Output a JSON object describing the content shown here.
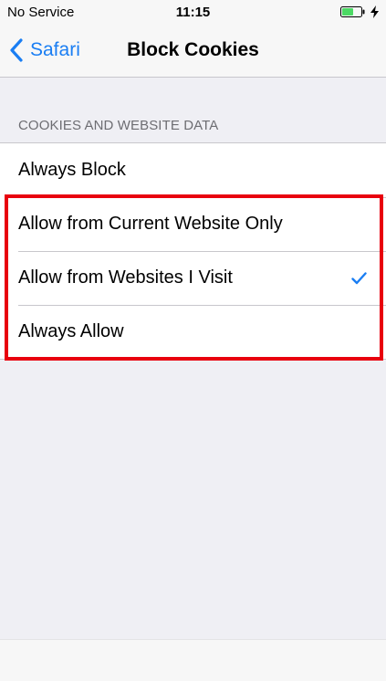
{
  "status_bar": {
    "carrier": "No Service",
    "time": "11:15",
    "battery_icon": "battery-charging-icon",
    "battery_color": "#4cd964"
  },
  "nav_bar": {
    "back_label": "Safari",
    "title": "Block Cookies",
    "accent_color": "#1a7ef3"
  },
  "section": {
    "header": "COOKIES AND WEBSITE DATA",
    "options": [
      {
        "label": "Always Block",
        "selected": false
      },
      {
        "label": "Allow from Current Website Only",
        "selected": false
      },
      {
        "label": "Allow from Websites I Visit",
        "selected": true
      },
      {
        "label": "Always Allow",
        "selected": false
      }
    ]
  },
  "annotation": {
    "highlight_color": "#e8000e"
  }
}
